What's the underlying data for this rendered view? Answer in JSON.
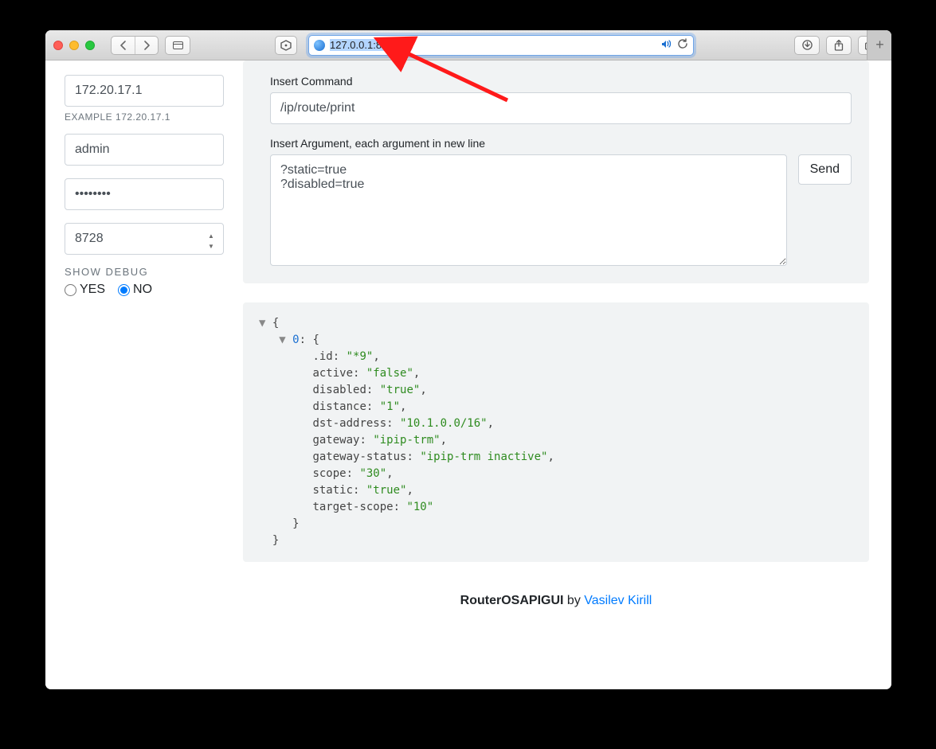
{
  "browser": {
    "url": "127.0.0.1:8081"
  },
  "sidebar": {
    "host_value": "172.20.17.1",
    "host_hint": "EXAMPLE 172.20.17.1",
    "user_value": "admin",
    "pass_value": "••••••••",
    "port_value": "8728",
    "debug_label": "SHOW DEBUG",
    "debug_yes": "YES",
    "debug_no": "NO"
  },
  "form": {
    "command_label": "Insert Command",
    "command_value": "/ip/route/print",
    "argument_label": "Insert Argument, each argument in new line",
    "argument_value": "?static=true\n?disabled=true",
    "send_label": "Send"
  },
  "result": {
    "0": {
      ".id": "*9",
      "active": "false",
      "disabled": "true",
      "distance": "1",
      "dst-address": "10.1.0.0/16",
      "gateway": "ipip-trm",
      "gateway-status": "ipip-trm inactive",
      "scope": "30",
      "static": "true",
      "target-scope": "10"
    }
  },
  "footer": {
    "app": "RouterOSAPIGUI",
    "by": " by ",
    "author": "Vasilev Kirill"
  }
}
